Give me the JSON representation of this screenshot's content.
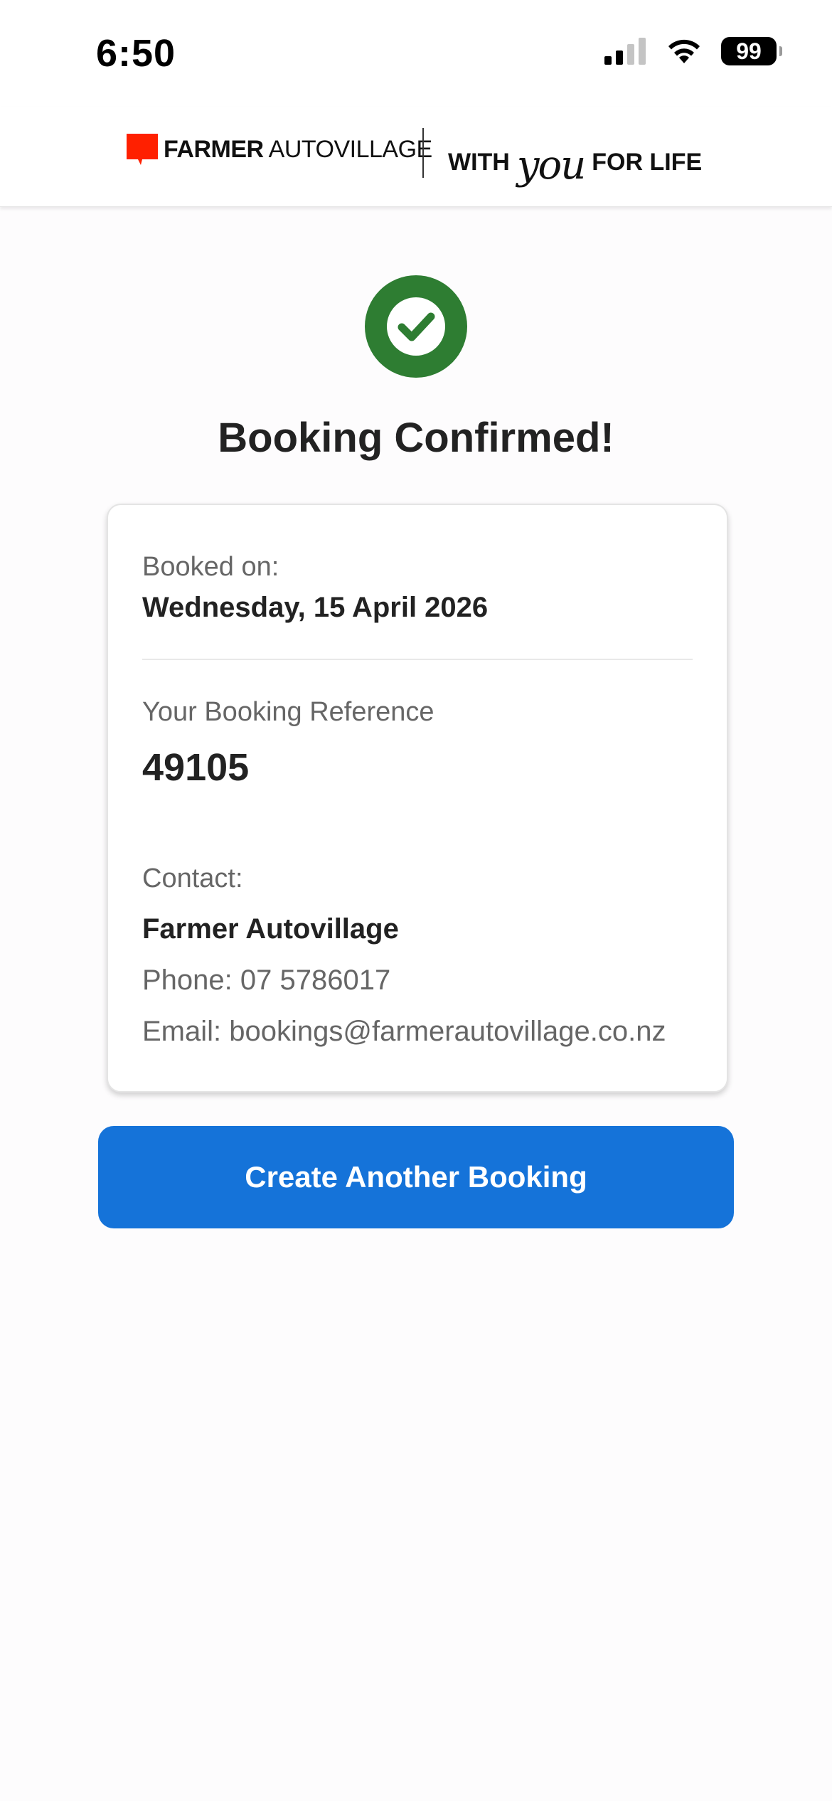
{
  "status_bar": {
    "time": "6:50",
    "battery": "99",
    "icons": [
      "cellular-signal-icon",
      "wifi-icon",
      "battery-icon"
    ]
  },
  "header": {
    "brand_bold": "FARMER",
    "brand_regular": "AUTOVILLAGE",
    "tagline_before": "WITH",
    "tagline_script": "you",
    "tagline_after": "FOR LIFE",
    "brand_color": "#ff2000"
  },
  "confirmation": {
    "icon": "check-circle-icon",
    "icon_color": "#2e7d32",
    "title": "Booking Confirmed!"
  },
  "details": {
    "booked_on_label": "Booked on:",
    "booked_on_value": "Wednesday, 15 April 2026",
    "reference_label": "Your Booking Reference",
    "reference_value": "49105",
    "contact_label": "Contact:",
    "contact_name": "Farmer Autovillage",
    "contact_phone": "Phone: 07 5786017",
    "contact_email": "Email: bookings@farmerautovillage.co.nz"
  },
  "actions": {
    "create_another_label": "Create Another Booking",
    "button_color": "#1573d9"
  }
}
